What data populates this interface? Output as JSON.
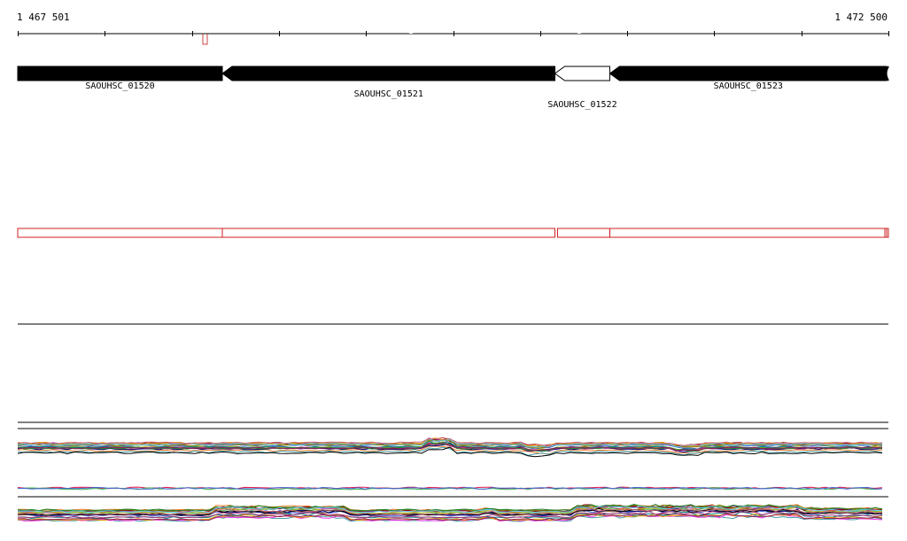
{
  "ruler": {
    "start_label": "1 467 501",
    "end_label": "1 472 500"
  },
  "genes": [
    {
      "name": "SAOUHSC_01520",
      "start_frac": 0.0,
      "end_frac": 0.235,
      "strand": "-",
      "filled": true
    },
    {
      "name": "SAOUHSC_01521",
      "start_frac": 0.235,
      "end_frac": 0.617,
      "strand": "-",
      "filled": true
    },
    {
      "name": "SAOUHSC_01522",
      "start_frac": 0.617,
      "end_frac": 0.68,
      "strand": "-",
      "filled": false
    },
    {
      "name": "SAOUHSC_01523",
      "start_frac": 0.68,
      "end_frac": 0.998,
      "strand": "-",
      "filled": true
    }
  ],
  "colors": {
    "gene_fill": "#000000",
    "gene_outline": "#000000",
    "annotation_outline": "#cc2222",
    "marker": "#cc4444",
    "axis": "#000000"
  }
}
